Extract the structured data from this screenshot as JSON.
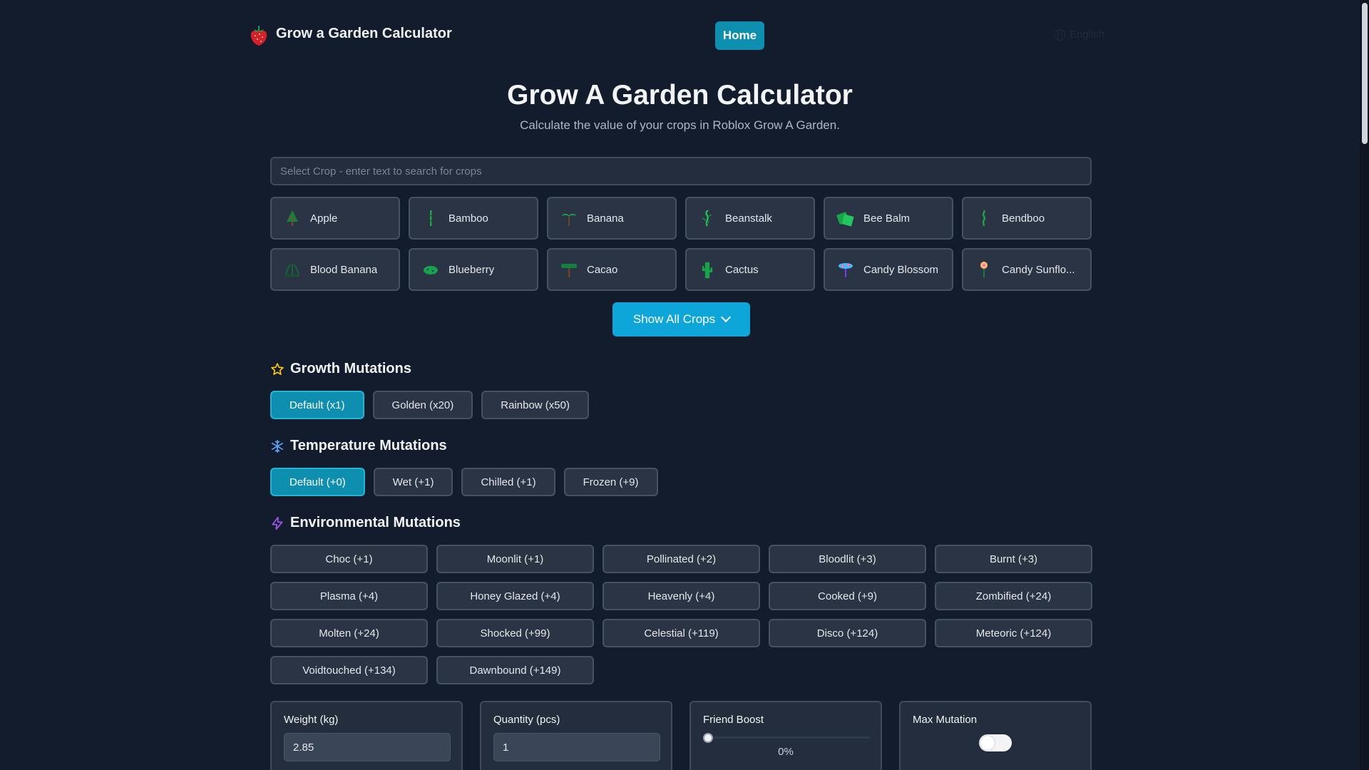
{
  "header": {
    "brand": "Grow a Garden Calculator",
    "nav_home": "Home",
    "language": "English"
  },
  "hero": {
    "title": "Grow A Garden Calculator",
    "subtitle": "Calculate the value of your crops in Roblox Grow A Garden."
  },
  "search": {
    "placeholder": "Select Crop - enter text to search for crops"
  },
  "crops": [
    {
      "label": "Apple",
      "icon": "apple-tree-icon"
    },
    {
      "label": "Bamboo",
      "icon": "bamboo-icon"
    },
    {
      "label": "Banana",
      "icon": "banana-tree-icon"
    },
    {
      "label": "Beanstalk",
      "icon": "beanstalk-icon"
    },
    {
      "label": "Bee Balm",
      "icon": "bee-balm-icon"
    },
    {
      "label": "Bendboo",
      "icon": "bendboo-icon"
    },
    {
      "label": "Blood Banana",
      "icon": "blood-banana-icon"
    },
    {
      "label": "Blueberry",
      "icon": "blueberry-bush-icon"
    },
    {
      "label": "Cacao",
      "icon": "cacao-tree-icon"
    },
    {
      "label": "Cactus",
      "icon": "cactus-icon"
    },
    {
      "label": "Candy Blossom",
      "icon": "candy-blossom-icon"
    },
    {
      "label": "Candy Sunflo...",
      "icon": "candy-sunflower-icon"
    }
  ],
  "show_all": "Show All Crops",
  "growth": {
    "title": "Growth Mutations",
    "options": [
      "Default (x1)",
      "Golden (x20)",
      "Rainbow (x50)"
    ],
    "selected": "Default (x1)"
  },
  "temperature": {
    "title": "Temperature Mutations",
    "options": [
      "Default (+0)",
      "Wet (+1)",
      "Chilled (+1)",
      "Frozen (+9)"
    ],
    "selected": "Default (+0)"
  },
  "environmental": {
    "title": "Environmental Mutations",
    "options": [
      "Choc (+1)",
      "Moonlit (+1)",
      "Pollinated (+2)",
      "Bloodlit (+3)",
      "Burnt (+3)",
      "Plasma (+4)",
      "Honey Glazed (+4)",
      "Heavenly (+4)",
      "Cooked (+9)",
      "Zombified (+24)",
      "Molten (+24)",
      "Shocked (+99)",
      "Celestial (+119)",
      "Disco (+124)",
      "Meteoric (+124)",
      "Voidtouched (+134)",
      "Dawnbound (+149)"
    ]
  },
  "inputs": {
    "weight_label": "Weight (kg)",
    "weight_value": "2.85",
    "quantity_label": "Quantity (pcs)",
    "quantity_value": "1",
    "friend_boost_label": "Friend Boost",
    "friend_boost_value": "0%",
    "friend_boost_fraction": 0,
    "max_mutation_label": "Max Mutation",
    "max_mutation_on": false
  },
  "colors": {
    "accent": "#0f8fb0",
    "background": "#131c2c"
  }
}
